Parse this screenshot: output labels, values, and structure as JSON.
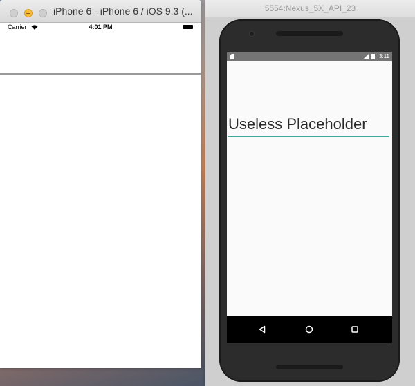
{
  "ios": {
    "window_title": "iPhone 6 - iPhone 6 / iOS 9.3 (...",
    "status": {
      "carrier": "Carrier",
      "time": "4:01 PM"
    }
  },
  "android": {
    "window_title": "5554:Nexus_5X_API_23",
    "status": {
      "time": "3:11"
    },
    "input": {
      "placeholder": "Useless Placeholder",
      "value": ""
    }
  },
  "colors": {
    "input_underline": "#3fa99a",
    "android_statusbar": "#757575",
    "traffic_minimize": "#f6bd3b"
  }
}
